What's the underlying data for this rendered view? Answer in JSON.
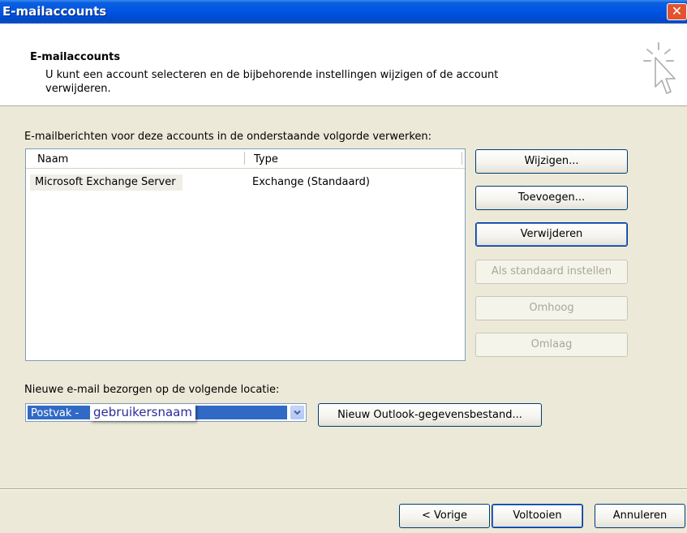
{
  "window": {
    "title": "E-mailaccounts",
    "close_glyph": "✕"
  },
  "header": {
    "title": "E-mailaccounts",
    "description": "U kunt een account selecteren en de bijbehorende instellingen wijzigen of de account verwijderen.",
    "icon": "wizard-cursor-icon"
  },
  "accounts": {
    "label": "E-mailberichten voor deze accounts in de onderstaande volgorde verwerken:",
    "columns": [
      "Naam",
      "Type"
    ],
    "rows": [
      {
        "name": "Microsoft Exchange Server",
        "type": "Exchange (Standaard)"
      }
    ]
  },
  "side_buttons": {
    "change": "Wijzigen...",
    "add": "Toevoegen...",
    "remove": "Verwijderen",
    "set_default": "Als standaard instellen",
    "up": "Omhoog",
    "down": "Omlaag"
  },
  "delivery": {
    "label": "Nieuwe e-mail bezorgen op de volgende locatie:",
    "selected_prefix": "Postvak -",
    "selected_user": "gebruikersnaam",
    "new_data_file_button": "Nieuw Outlook-gegevensbestand..."
  },
  "footer": {
    "back": "< Vorige",
    "finish": "Voltooien",
    "cancel": "Annuleren"
  },
  "colors": {
    "titlebar": "#0054e3",
    "selection": "#316ac5",
    "dialog_bg": "#ece9d8"
  }
}
